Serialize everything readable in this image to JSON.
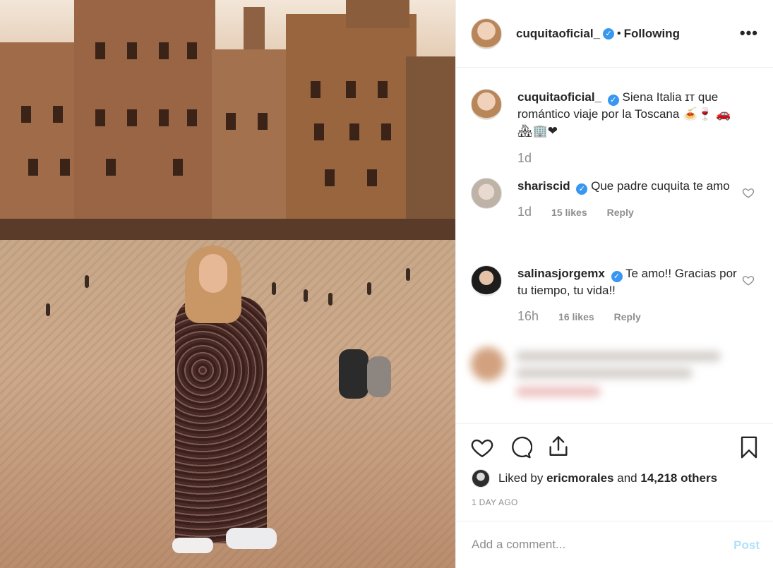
{
  "post": {
    "username": "cuquitaoficial_",
    "follow_status": "Following",
    "dot": "•",
    "more_label": "•••"
  },
  "caption": {
    "username": "cuquitaoficial_",
    "text": "Siena Italia ɪᴛ que romántico viaje por la Toscana",
    "emoji_line1": "🍝🍷",
    "emoji_line2": "🚗🏘🏢❤",
    "time": "1d"
  },
  "comments": [
    {
      "username": "shariscid",
      "text": "Que padre cuquita te amo",
      "time": "1d",
      "likes": "15 likes",
      "reply": "Reply"
    },
    {
      "username": "salinasjorgemx",
      "text": "Te amo!! Gracias por tu tiempo, tu vida!!",
      "time": "16h",
      "likes": "16 likes",
      "reply": "Reply"
    }
  ],
  "likes": {
    "prefix": "Liked by",
    "user": "ericmorales",
    "and": "and",
    "others": "14,218 others"
  },
  "timestamp": "1 DAY AGO",
  "add_comment": {
    "placeholder": "Add a comment...",
    "post_label": "Post"
  },
  "icons": {
    "like": "heart-icon",
    "comment": "comment-icon",
    "share": "share-icon",
    "save": "bookmark-icon",
    "verified": "verified-badge-icon"
  },
  "colors": {
    "verified": "#3897f0",
    "post_disabled": "#b2dffc",
    "muted": "#8e8e8e",
    "text": "#262626"
  }
}
